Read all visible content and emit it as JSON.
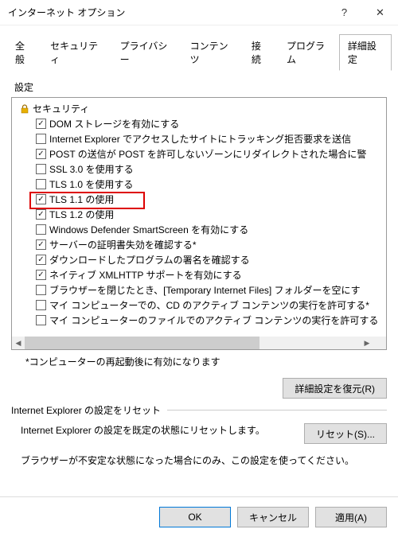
{
  "window": {
    "title": "インターネット オプション",
    "help_glyph": "?",
    "close_glyph": "✕"
  },
  "tabs": [
    "全般",
    "セキュリティ",
    "プライバシー",
    "コンテンツ",
    "接続",
    "プログラム",
    "詳細設定"
  ],
  "active_tab_index": 6,
  "settings_label": "設定",
  "tree": {
    "category": "セキュリティ",
    "items": [
      {
        "checked": true,
        "label": "DOM ストレージを有効にする"
      },
      {
        "checked": false,
        "label": "Internet Explorer でアクセスしたサイトにトラッキング拒否要求を送信"
      },
      {
        "checked": true,
        "label": "POST の送信が POST を許可しないゾーンにリダイレクトされた場合に警"
      },
      {
        "checked": false,
        "label": "SSL 3.0 を使用する"
      },
      {
        "checked": false,
        "label": "TLS 1.0 を使用する"
      },
      {
        "checked": true,
        "label": "TLS 1.1 の使用"
      },
      {
        "checked": true,
        "label": "TLS 1.2 の使用"
      },
      {
        "checked": false,
        "label": "Windows Defender SmartScreen を有効にする"
      },
      {
        "checked": true,
        "label": "サーバーの証明書失効を確認する*"
      },
      {
        "checked": true,
        "label": "ダウンロードしたプログラムの署名を確認する"
      },
      {
        "checked": true,
        "label": "ネイティブ XMLHTTP サポートを有効にする"
      },
      {
        "checked": false,
        "label": "ブラウザーを閉じたとき、[Temporary Internet Files] フォルダーを空にす"
      },
      {
        "checked": false,
        "label": "マイ コンピューターでの、CD のアクティブ コンテンツの実行を許可する*"
      },
      {
        "checked": false,
        "label": "マイ コンピューターのファイルでのアクティブ コンテンツの実行を許可する"
      }
    ]
  },
  "note": "*コンピューターの再起動後に有効になります",
  "restore_button": "詳細設定を復元(R)",
  "reset_group": {
    "legend": "Internet Explorer の設定をリセット",
    "text": "Internet Explorer の設定を既定の状態にリセットします。",
    "button": "リセット(S)...",
    "warning": "ブラウザーが不安定な状態になった場合にのみ、この設定を使ってください。"
  },
  "footer": {
    "ok": "OK",
    "cancel": "キャンセル",
    "apply": "適用(A)"
  }
}
